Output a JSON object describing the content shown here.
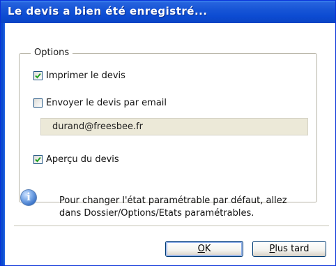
{
  "window": {
    "title": "Le devis a bien été enregistré..."
  },
  "options_group": {
    "legend": "Options"
  },
  "checkboxes": [
    {
      "label": "Imprimer le devis",
      "checked": true
    },
    {
      "label": "Envoyer le devis par email",
      "checked": false
    },
    {
      "label": "Aperçu du devis",
      "checked": true
    }
  ],
  "email": {
    "value": "durand@freesbee.fr"
  },
  "info": {
    "line1": "Pour changer l'état paramétrable par défaut, allez",
    "line2": "dans Dossier/Options/Etats paramétrables."
  },
  "buttons": {
    "ok_underlined": "O",
    "ok_rest": "K",
    "later_underlined": "P",
    "later_rest": "lus tard"
  },
  "colors": {
    "titlebar": "#0c4bd2",
    "checkmark": "#21a121",
    "window_bg": "#ece9d8"
  }
}
